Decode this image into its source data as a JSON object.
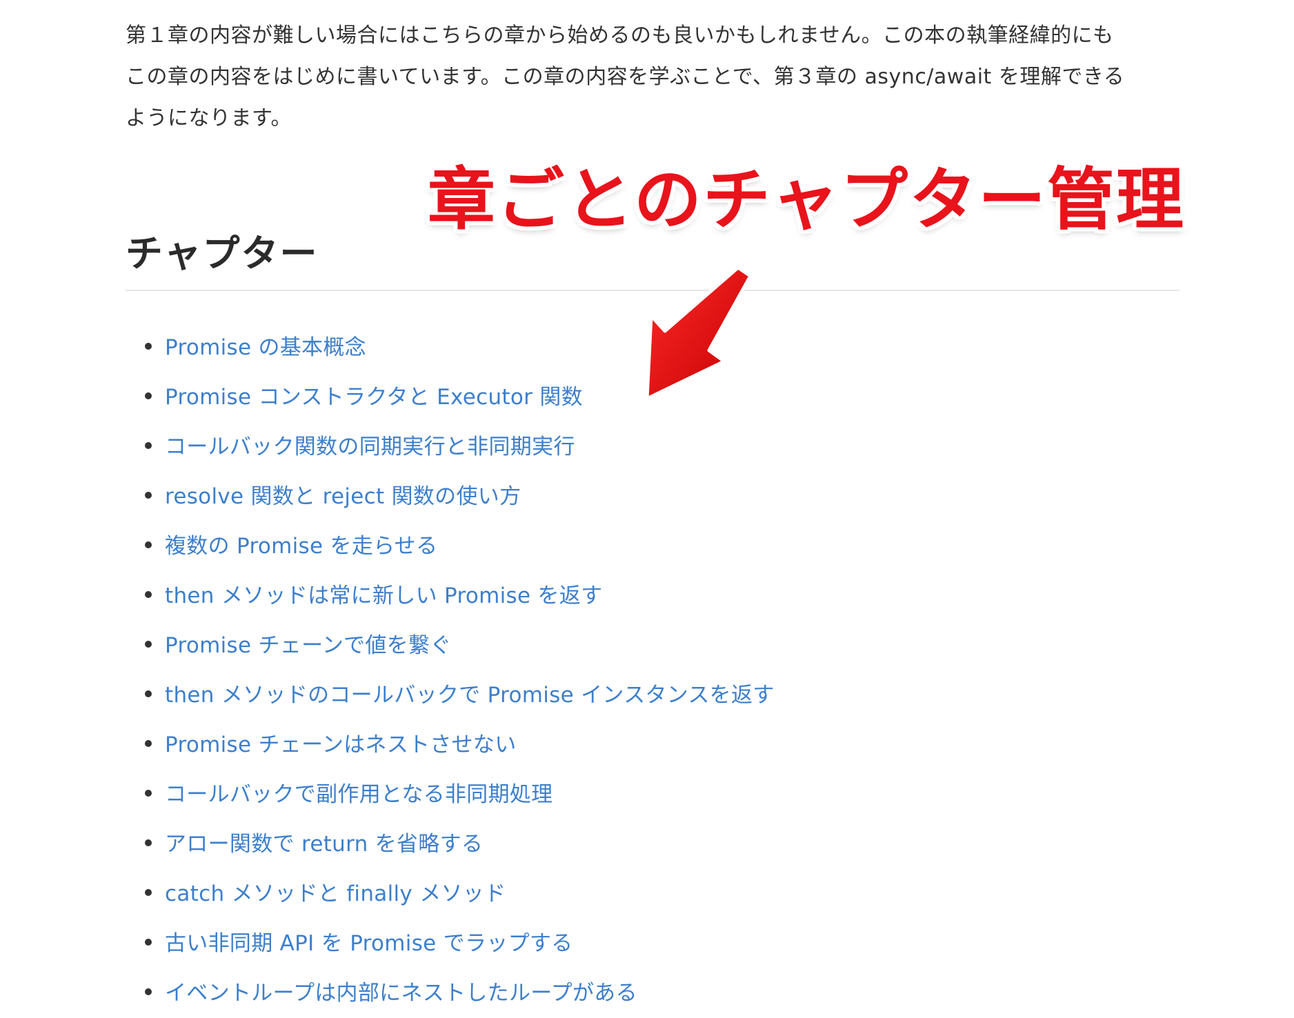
{
  "intro": {
    "line1": "第１章の内容が難しい場合にはこちらの章から始めるのも良いかもしれません。この本の執筆経緯的にも",
    "line2": "この章の内容をはじめに書いています。この章の内容を学ぶことで、第３章の async/await を理解できる",
    "line3": "ようになります。"
  },
  "section": {
    "heading": "チャプター"
  },
  "annotation": {
    "text": "章ごとのチャプター管理",
    "color": "#e8131b",
    "arrow_icon": "arrow-down-left-icon"
  },
  "chapters": [
    {
      "label": "Promise の基本概念"
    },
    {
      "label": "Promise コンストラクタと Executor 関数"
    },
    {
      "label": "コールバック関数の同期実行と非同期実行"
    },
    {
      "label": "resolve 関数と reject 関数の使い方"
    },
    {
      "label": "複数の Promise を走らせる"
    },
    {
      "label": "then メソッドは常に新しい Promise を返す"
    },
    {
      "label": "Promise チェーンで値を繋ぐ"
    },
    {
      "label": "then メソッドのコールバックで Promise インスタンスを返す"
    },
    {
      "label": "Promise チェーンはネストさせない"
    },
    {
      "label": "コールバックで副作用となる非同期処理"
    },
    {
      "label": "アロー関数で return を省略する"
    },
    {
      "label": "catch メソッドと finally メソッド"
    },
    {
      "label": "古い非同期 API を Promise でラップする"
    },
    {
      "label": "イベントループは内部にネストしたループがある"
    }
  ],
  "colors": {
    "link": "#3d7fcc",
    "text": "#333333",
    "divider": "#e6e6e6"
  }
}
